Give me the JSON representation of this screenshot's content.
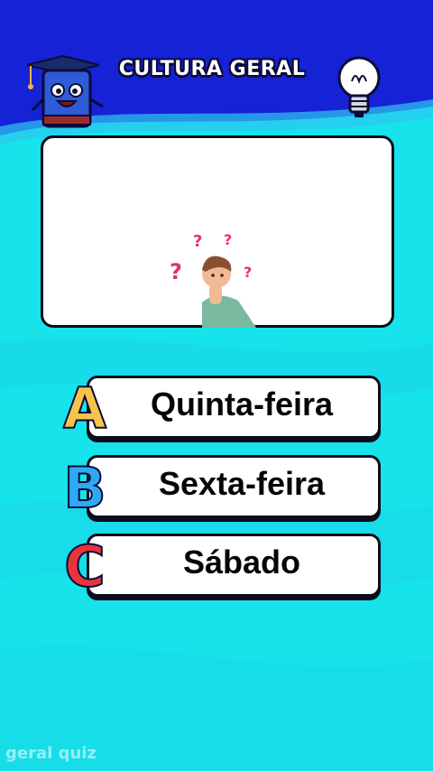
{
  "header": {
    "title": "CULTURA GERAL",
    "mascot_icon": "book-mascot-icon",
    "bulb_icon": "lightbulb-icon"
  },
  "question": {
    "illustration": "confused-person-icon"
  },
  "answers": [
    {
      "letter": "A",
      "text": "Quinta-feira",
      "color": "#f6c44a"
    },
    {
      "letter": "B",
      "text": "Sexta-feira",
      "color": "#2fa9f2"
    },
    {
      "letter": "C",
      "text": "Sábado",
      "color": "#e8343d"
    }
  ],
  "watermark": "geral quiz",
  "colors": {
    "sky": "#1622d6",
    "sea": "#16e3ea"
  }
}
